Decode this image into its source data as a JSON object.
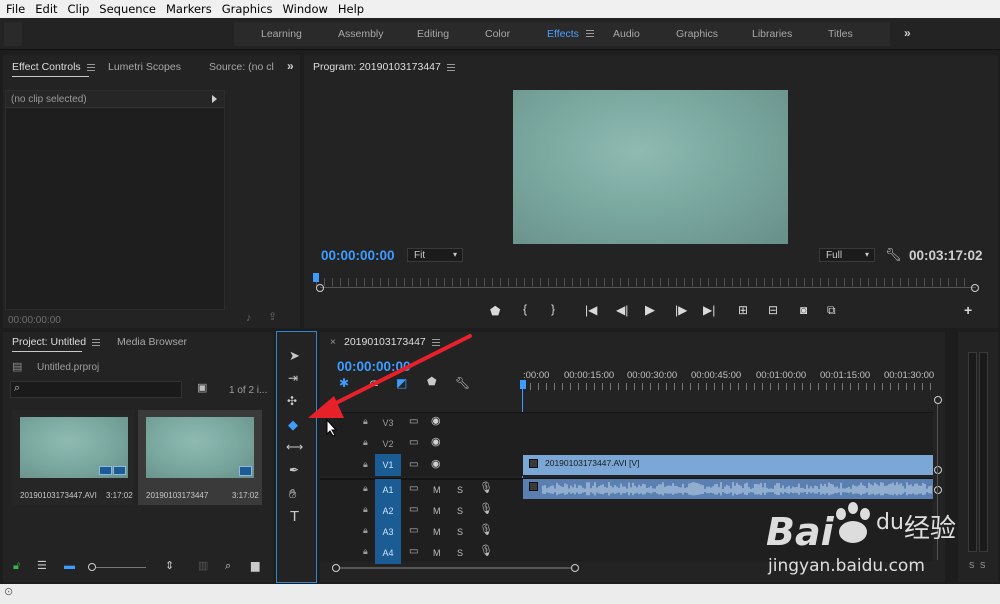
{
  "menu": [
    "File",
    "Edit",
    "Clip",
    "Sequence",
    "Markers",
    "Graphics",
    "Window",
    "Help"
  ],
  "workspaces": [
    {
      "label": "Learning",
      "active": false
    },
    {
      "label": "Assembly",
      "active": false
    },
    {
      "label": "Editing",
      "active": false
    },
    {
      "label": "Color",
      "active": false
    },
    {
      "label": "Effects",
      "active": true
    },
    {
      "label": "Audio",
      "active": false
    },
    {
      "label": "Graphics",
      "active": false
    },
    {
      "label": "Libraries",
      "active": false
    },
    {
      "label": "Titles",
      "active": false
    }
  ],
  "source_panel": {
    "tabs": [
      "Effect Controls",
      "Lumetri Scopes",
      "Source: (no cl"
    ],
    "no_clip": "(no clip selected)",
    "timecode": "00:00:00:00"
  },
  "program": {
    "title": "Program: 20190103173447",
    "timecode": "00:00:00:00",
    "fit": "Fit",
    "quality": "Full",
    "duration": "00:03:17:02"
  },
  "project": {
    "tabs": [
      "Project: Untitled",
      "Media Browser"
    ],
    "file": "Untitled.prproj",
    "count": "1 of 2 i...",
    "items": [
      {
        "name": "20190103173447.AVI",
        "duration": "3:17:02"
      },
      {
        "name": "20190103173447",
        "duration": "3:17:02"
      }
    ]
  },
  "timeline": {
    "sequence": "20190103173447",
    "timecode": "00:00:00:00",
    "ruler": [
      ":00:00",
      "00:00:15:00",
      "00:00:30:00",
      "00:00:45:00",
      "00:01:00:00",
      "00:01:15:00",
      "00:01:30:00"
    ],
    "video_tracks": [
      "V3",
      "V2",
      "V1"
    ],
    "audio_tracks": [
      "A1",
      "A2",
      "A3",
      "A4"
    ],
    "clip_label": "20190103173447.AVI [V]",
    "audio_ms": "M",
    "audio_ss": "S"
  },
  "meter": {
    "s_left": "S",
    "s_right": "S"
  },
  "watermark": {
    "brand": "Bai",
    "du": "du",
    "cn": "经验",
    "url": "jingyan.baidu.com"
  },
  "colors": {
    "accent": "#3e9cff",
    "clip": "#7aa7d6",
    "annotation": "#e8202a",
    "track_on": "#1a5c93"
  }
}
